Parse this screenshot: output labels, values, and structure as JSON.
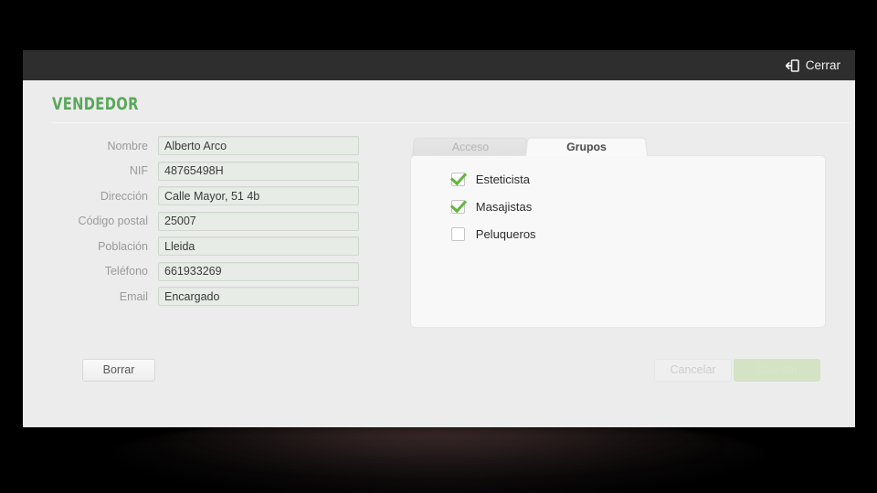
{
  "titlebar": {
    "close_label": "Cerrar",
    "close_icon": "logout-icon"
  },
  "page_title": "VENDEDOR",
  "accent_color": "#5aa85a",
  "form": {
    "fields": [
      {
        "label": "Nombre",
        "value": "Alberto Arco"
      },
      {
        "label": "NIF",
        "value": "48765498H"
      },
      {
        "label": "Dirección",
        "value": "Calle Mayor, 51 4b"
      },
      {
        "label": "Código postal",
        "value": "25007"
      },
      {
        "label": "Población",
        "value": "Lleida"
      },
      {
        "label": "Teléfono",
        "value": "661933269"
      },
      {
        "label": "Email",
        "value": "Encargado"
      }
    ]
  },
  "tabs": [
    {
      "label": "Acceso",
      "active": false
    },
    {
      "label": "Grupos",
      "active": true
    }
  ],
  "groups": [
    {
      "label": "Esteticista",
      "checked": true
    },
    {
      "label": "Masajistas",
      "checked": true
    },
    {
      "label": "Peluqueros",
      "checked": false
    }
  ],
  "footer": {
    "delete_label": "Borrar",
    "cancel_label": "Cancelar",
    "save_label": "Guardar"
  }
}
